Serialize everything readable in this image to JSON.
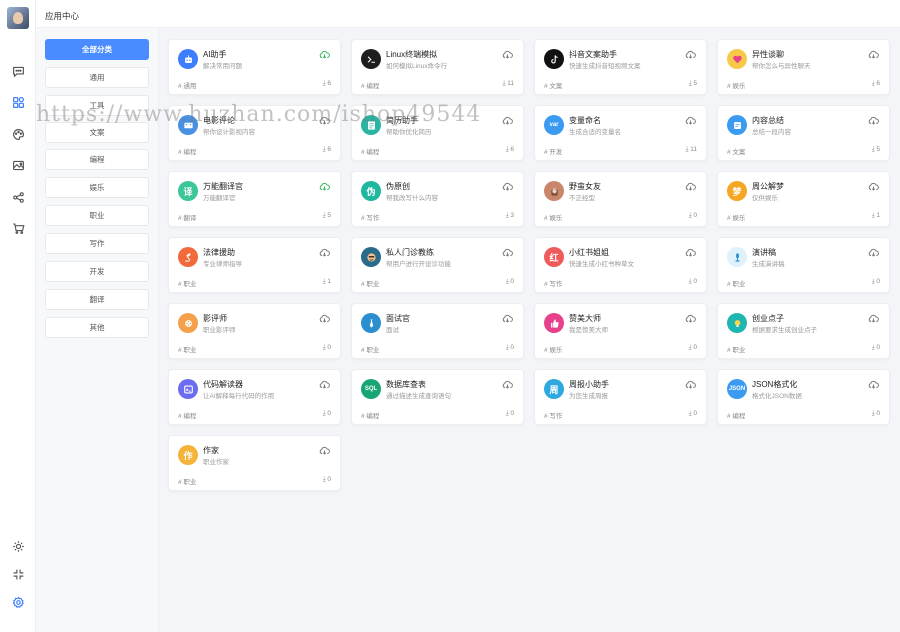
{
  "header": {
    "title": "应用中心"
  },
  "categories": [
    {
      "label": "全部分类",
      "active": true
    },
    {
      "label": "通用"
    },
    {
      "label": "工具"
    },
    {
      "label": "文案"
    },
    {
      "label": "编程"
    },
    {
      "label": "娱乐"
    },
    {
      "label": "职业"
    },
    {
      "label": "写作"
    },
    {
      "label": "开发"
    },
    {
      "label": "翻译"
    },
    {
      "label": "其他"
    }
  ],
  "rail_icons": [
    "chat-icon",
    "apps-icon",
    "palette-icon",
    "image-icon",
    "share-icon",
    "cart-icon",
    "sun-icon",
    "collapse-icon",
    "settings-icon"
  ],
  "cards": [
    {
      "title": "AI助手",
      "desc": "解决常用问题",
      "tag": "# 通用",
      "count": "6",
      "icon": "robot",
      "color": "#3d7eff",
      "cloud": "#35b55a"
    },
    {
      "title": "Linux终端模拟",
      "desc": "如何模拟Linux命令行",
      "tag": "# 编程",
      "count": "11",
      "icon": "terminal",
      "color": "#1e1e1e",
      "cloud": "#777"
    },
    {
      "title": "抖音文案助手",
      "desc": "快速生成抖音短视频文案",
      "tag": "# 文案",
      "count": "5",
      "icon": "tiktok",
      "color": "#111111",
      "cloud": "#777"
    },
    {
      "title": "异性谈聊",
      "desc": "帮你怎么与异性聊天",
      "tag": "# 娱乐",
      "count": "6",
      "icon": "heart",
      "color": "#f7c948",
      "cloud": "#777"
    },
    {
      "title": "电影评论",
      "desc": "帮你设计影视内容",
      "tag": "# 编程",
      "count": "6",
      "icon": "film",
      "color": "#4a90e2",
      "cloud": "#777"
    },
    {
      "title": "简历助手",
      "desc": "帮助你优化简历",
      "tag": "# 编程",
      "count": "6",
      "icon": "doc",
      "color": "#2bb3a3",
      "cloud": "#777"
    },
    {
      "title": "变量命名",
      "desc": "生成合适的变量名",
      "tag": "# 开发",
      "count": "11",
      "text": "var",
      "color": "#3a9bf0",
      "cloud": "#777"
    },
    {
      "title": "内容总结",
      "desc": "总结一段内容",
      "tag": "# 文案",
      "count": "5",
      "icon": "note",
      "color": "#3a9bf0",
      "cloud": "#777"
    },
    {
      "title": "万能翻译官",
      "desc": "万能翻译官",
      "tag": "# 翻译",
      "count": "5",
      "text": "译",
      "color": "#3cc79a",
      "cloud": "#35b55a"
    },
    {
      "title": "伪原创",
      "desc": "帮我改写什么内容",
      "tag": "# 写作",
      "count": "3",
      "text": "伪",
      "color": "#1fb7a0",
      "cloud": "#777"
    },
    {
      "title": "野蛮女友",
      "desc": "不正经型",
      "tag": "# 娱乐",
      "count": "0",
      "icon": "girl",
      "color": "#c9866b",
      "cloud": "#777"
    },
    {
      "title": "周公解梦",
      "desc": "仅供娱乐",
      "tag": "# 娱乐",
      "count": "1",
      "text": "梦",
      "color": "#f5a623",
      "cloud": "#777"
    },
    {
      "title": "法律援助",
      "desc": "专业律师指导",
      "tag": "# 职业",
      "count": "1",
      "icon": "gavel",
      "color": "#f06a3c",
      "cloud": "#777"
    },
    {
      "title": "私人门诊教练",
      "desc": "帮用户进行开设诊功能",
      "tag": "# 职业",
      "count": "0",
      "icon": "face",
      "color": "#2a6a8a",
      "cloud": "#777"
    },
    {
      "title": "小红书姐姐",
      "desc": "快速生成小红书种草文",
      "tag": "# 写作",
      "count": "0",
      "text": "红",
      "color": "#ef5b5b",
      "cloud": "#777"
    },
    {
      "title": "演讲稿",
      "desc": "生成演讲稿",
      "tag": "# 职业",
      "count": "0",
      "icon": "mic",
      "color": "#dff1fb",
      "cloud": "#777"
    },
    {
      "title": "影评师",
      "desc": "职业影评师",
      "tag": "# 职业",
      "count": "0",
      "icon": "reel",
      "color": "#f5a04a",
      "cloud": "#777"
    },
    {
      "title": "面试官",
      "desc": "面试",
      "tag": "# 职业",
      "count": "0",
      "icon": "tie",
      "color": "#2b8fcf",
      "cloud": "#777"
    },
    {
      "title": "赞美大师",
      "desc": "我是赞美大师",
      "tag": "# 娱乐",
      "count": "0",
      "icon": "thumb",
      "color": "#e8418c",
      "cloud": "#777"
    },
    {
      "title": "创业点子",
      "desc": "根据要求生成创业点子",
      "tag": "# 职业",
      "count": "0",
      "icon": "bulb",
      "color": "#1fb6b1",
      "cloud": "#777"
    },
    {
      "title": "代码解读器",
      "desc": "让AI解释每行代码的作用",
      "tag": "# 编程",
      "count": "0",
      "icon": "code",
      "color": "#6c6cf0",
      "cloud": "#777"
    },
    {
      "title": "数据库查表",
      "desc": "通过描述生成查询语句",
      "tag": "# 编程",
      "count": "0",
      "text": "SQL",
      "color": "#17a673",
      "cloud": "#777"
    },
    {
      "title": "周报小助手",
      "desc": "为您生成周报",
      "tag": "# 写作",
      "count": "0",
      "text": "周",
      "color": "#2fa8e0",
      "cloud": "#777"
    },
    {
      "title": "JSON格式化",
      "desc": "格式化JSON数据",
      "tag": "# 编程",
      "count": "0",
      "text": "JSON",
      "color": "#3a9bf0",
      "cloud": "#777"
    },
    {
      "title": "作家",
      "desc": "职业作家",
      "tag": "# 职业",
      "count": "0",
      "text": "作",
      "color": "#f5b33a",
      "cloud": "#777"
    }
  ],
  "watermark": "https://www.huzhan.com/ishop49544"
}
